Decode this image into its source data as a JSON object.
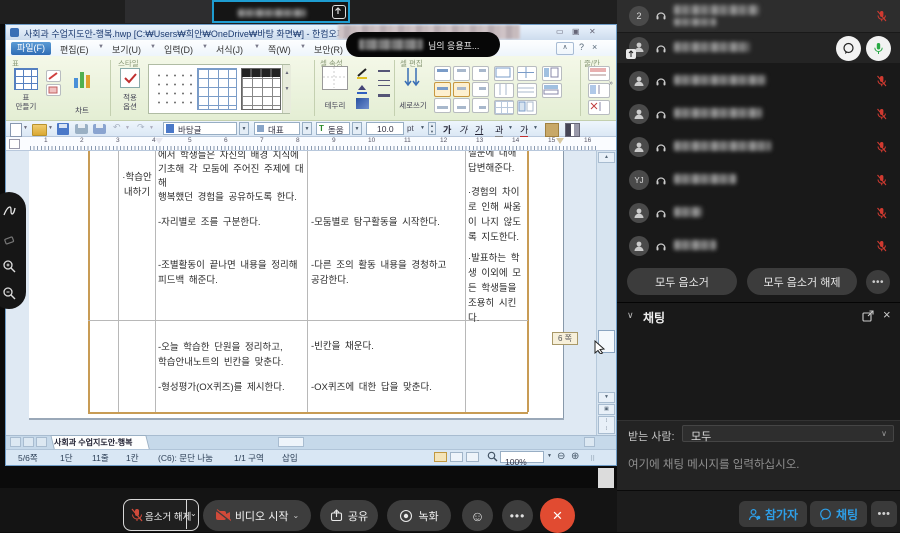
{
  "zoom_ui": {
    "overlay_badge": "님의 응용프...",
    "controls": {
      "unmute": "음소거 해제",
      "start_video": "비디오 시작",
      "share": "공유",
      "record": "녹화",
      "more": "...",
      "close": "×"
    },
    "participants": {
      "rows": [
        {
          "avatar": "2"
        },
        {
          "avatar": ""
        },
        {
          "avatar": ""
        },
        {
          "avatar": ""
        },
        {
          "avatar": ""
        },
        {
          "avatar": "YJ"
        },
        {
          "avatar": ""
        },
        {
          "avatar": ""
        }
      ],
      "mute_all": "모두 음소거",
      "unmute_all": "모두 음소거 해제",
      "more": "..."
    },
    "chat": {
      "title": "채팅",
      "to_label": "받는 사람:",
      "to_value": "모두",
      "placeholder": "여기에 채팅 메시지를 입력하십시오.",
      "close": "×"
    },
    "footer": {
      "participants": "참가자",
      "chat": "채팅",
      "more": "..."
    }
  },
  "hwp": {
    "title": "사회과 수업지도안-행복.hwp [C:₩Users₩희안₩OneDrive₩바탕 화면₩] - 한컴오피",
    "menus": {
      "file": "파일(F)",
      "edit": "편집(E)",
      "view": "보기(U)",
      "input": "입력(D)",
      "format": "서식(J)",
      "page": "쪽(W)",
      "security": "보안(R)"
    },
    "ribbon": {
      "groups": {
        "table": "표",
        "style": "스타일",
        "cell_props": "셀 속성",
        "cell_edit": "셀 편집",
        "rows_cols": "줄/칸"
      },
      "create_table": "표\n만들기",
      "chart": "차트",
      "apply_options": "적용\n옵션",
      "border": "테두리",
      "vertical_text": "세로쓰기"
    },
    "format_bar": {
      "para_style": "바탕글",
      "char_style": "대표",
      "font": "돋움",
      "font_size": "10.0",
      "unit": "pt",
      "bold": "가",
      "italic": "가",
      "underline": "가",
      "shade": "과",
      "color": "가"
    },
    "ruler_numbers": [
      "1",
      "2",
      "3",
      "4",
      "5",
      "6",
      "7",
      "8",
      "9",
      "10",
      "11",
      "12",
      "13",
      "14",
      "15",
      "16"
    ],
    "doc": {
      "row1_label": "·학습안\n내하기",
      "r1_teacher_p1": "에서 학생들은 자신의 배경 지식에\n기초해 각 모둠에 주어진 주제에 대해\n행복했던 경험을 공유하도록 한다.",
      "r1_teacher_p2": "-자리별로 조를 구분한다.",
      "r1_teacher_p3": "-조별활동이 끝나면 내용을 정리해\n피드백 해준다.",
      "r1_student_p1": "-모둠별로 탐구활동을 시작한다.",
      "r1_student_p2": "-다른 조의 활동 내용을 경청하고\n공감한다.",
      "r1_notes_p1": "질문에 대해\n답변해준다.",
      "r1_notes_p2": "·경험의 차이\n로 인해 싸움\n이 나지 않도\n록 지도한다.",
      "r1_notes_p3": "·발표하는 학\n생 이외에 모\n든 학생들을\n조용히 시킨\n다.",
      "r2_teacher_p1": "-오늘 학습한 단원을 정리하고,\n학습안내노트의 빈칸을 맞춘다.",
      "r2_teacher_p2": "-형성평가(OX퀴즈)를 제시한다.",
      "r2_student_p1": "-빈칸을 채운다.",
      "r2_student_p2": "-OX퀴즈에 대한 답을 맞춘다."
    },
    "page_tooltip": "6 쪽",
    "doc_tab": "사회과 수업지도안-행복",
    "status": {
      "page": "5/6쪽",
      "column": "1단",
      "line": "11줄",
      "char": "1칸",
      "info": "(C6): 문단 나눔",
      "section": "1/1 구역",
      "insert": "삽입",
      "zoom": "100%"
    }
  }
}
